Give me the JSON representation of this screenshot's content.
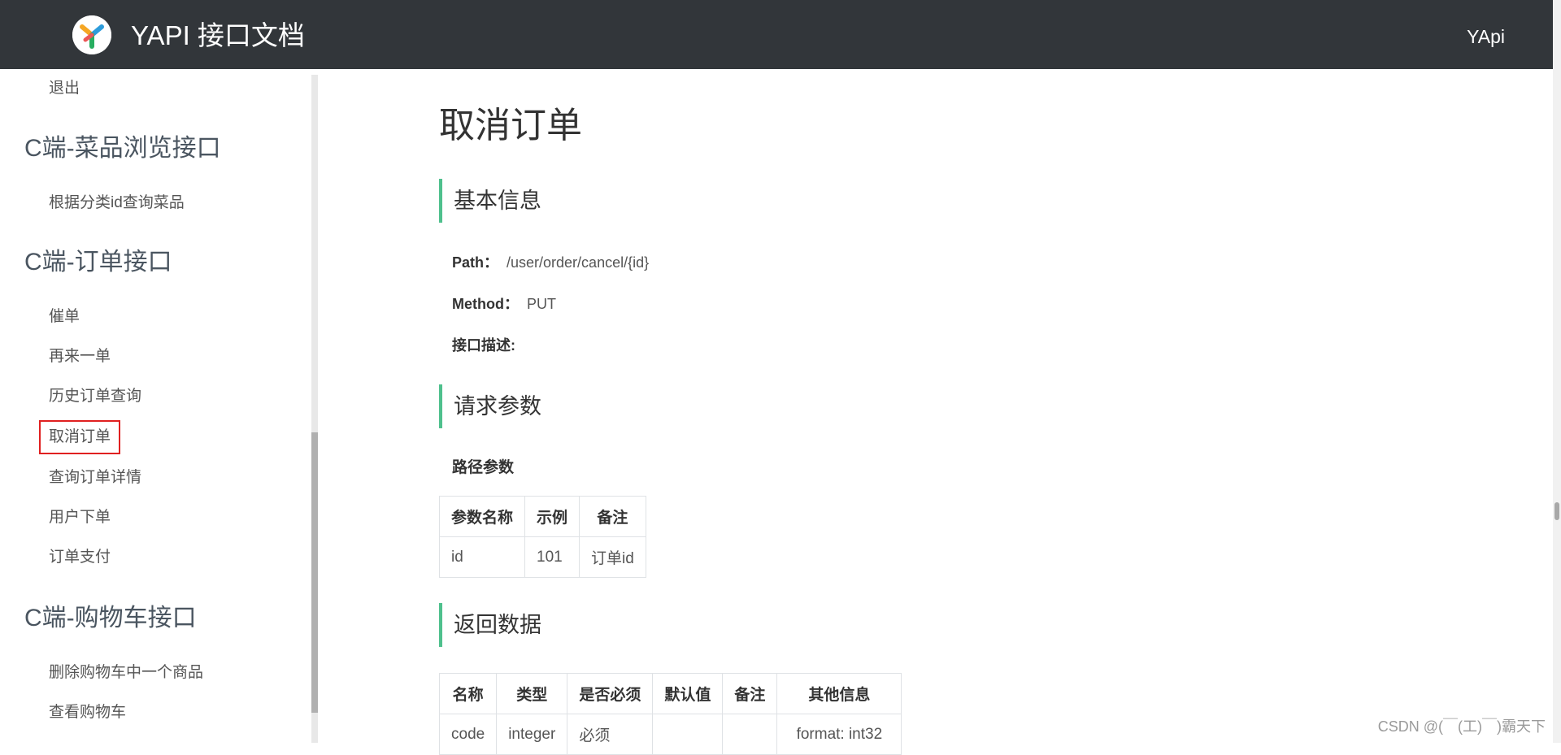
{
  "header": {
    "title": "YAPI 接口文档",
    "right_link": "YApi"
  },
  "sidebar": {
    "top_item": "退出",
    "groups": [
      {
        "heading": "C端-菜品浏览接口",
        "items": [
          "根据分类id查询菜品"
        ]
      },
      {
        "heading": "C端-订单接口",
        "items": [
          "催单",
          "再来一单",
          "历史订单查询",
          "取消订单",
          "查询订单详情",
          "用户下单",
          "订单支付"
        ]
      },
      {
        "heading": "C端-购物车接口",
        "items": [
          "删除购物车中一个商品",
          "查看购物车"
        ]
      }
    ],
    "active_item": "取消订单"
  },
  "main": {
    "title": "取消订单",
    "basic_info": {
      "heading": "基本信息",
      "path_label": "Path：",
      "path_value": "/user/order/cancel/{id}",
      "method_label": "Method：",
      "method_value": "PUT",
      "desc_label": "接口描述:"
    },
    "request": {
      "heading": "请求参数",
      "path_params_label": "路径参数",
      "columns": [
        "参数名称",
        "示例",
        "备注"
      ],
      "rows": [
        [
          "id",
          "101",
          "订单id"
        ]
      ]
    },
    "response": {
      "heading": "返回数据",
      "columns": [
        "名称",
        "类型",
        "是否必须",
        "默认值",
        "备注",
        "其他信息"
      ],
      "rows": [
        [
          "code",
          "integer",
          "必须",
          "",
          "",
          "format: int32"
        ]
      ]
    }
  },
  "watermark": "CSDN @(￣(工)￣)霸天下",
  "colors": {
    "header_bg": "#32363a",
    "accent": "#4fc08d",
    "highlight": "#e02020"
  }
}
